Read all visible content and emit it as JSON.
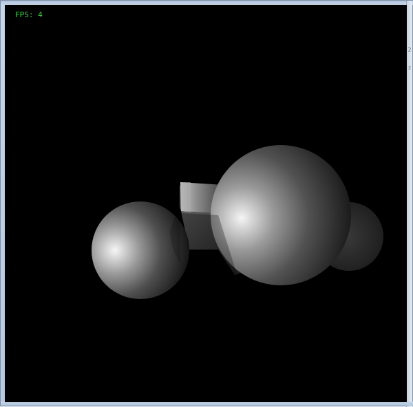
{
  "viewport": {
    "fps_label": "FPS: 4",
    "background": "#000000",
    "fps_color": "#39d43f"
  },
  "scene": {
    "objects": [
      "left-sphere",
      "right-sphere",
      "rear-sphere",
      "connector-cube"
    ]
  },
  "frame": {
    "edge_marks": [
      "2",
      "z"
    ]
  }
}
